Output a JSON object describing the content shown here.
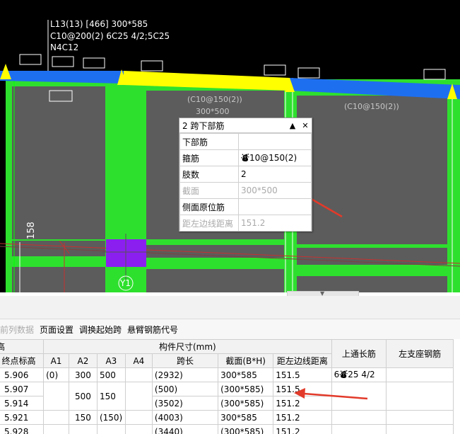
{
  "drawing": {
    "beam_annotation": [
      "L13(13) [466] 300*585",
      "C10@200(2) 6C25 4/2;5C25",
      "N4C12"
    ],
    "span_label_1": "(C10@150(2))",
    "span_size_1": "300*500",
    "span_label_2": "(C10@150(2))",
    "dimension_label": "158",
    "column_label": "Y1",
    "colors": {
      "background": "#000000",
      "beam_blue": "#1e6ff0",
      "beam_yellow": "#ffff00",
      "green": "#2ee02e",
      "slab_gray": "#5c5c5c",
      "column_purple": "#8a1ff0"
    }
  },
  "panel": {
    "title": "2 跨下部筋",
    "rows": [
      {
        "label": "下部筋",
        "value": ""
      },
      {
        "label": "箍筋",
        "value": "⛇10@150(2)"
      },
      {
        "label": "肢数",
        "value": "2"
      },
      {
        "label": "截面",
        "value": "300*500"
      },
      {
        "label": "侧面原位筋",
        "value": ""
      },
      {
        "label": "距左边线距离",
        "value": "151.2"
      }
    ]
  },
  "toolbar": {
    "items": [
      "当前列数据",
      "页面设置",
      "调换起始跨",
      "悬臂钢筋代号"
    ]
  },
  "table": {
    "group_header_left": "高",
    "group_header_mid": "构件尺寸(mm)",
    "col_headers": [
      "终点标高",
      "A1",
      "A2",
      "A3",
      "A4",
      "跨长",
      "截面(B*H)",
      "距左边线距离"
    ],
    "col_upper_rebar": "上通长筋",
    "col_left_support": "左支座钢筋",
    "rows": [
      {
        "end_elev": "5.906",
        "a1": "(0)",
        "a2": "300",
        "a3": "500",
        "a4": "",
        "span": "(2932)",
        "section": "300*585",
        "dist": "151.5",
        "upper": "6⛇25 4/2",
        "left": ""
      },
      {
        "end_elev": "5.907",
        "a1": "",
        "a2": "",
        "a3": "",
        "a4": "",
        "span": "(500)",
        "section": "(300*585)",
        "dist": "151.5",
        "upper": "",
        "left": ""
      },
      {
        "end_elev": "5.914",
        "a1": "",
        "a2": "500",
        "a3": "150",
        "a4": "",
        "span": "(3502)",
        "section": "(300*585)",
        "dist": "151.2",
        "upper": "",
        "left": ""
      },
      {
        "end_elev": "5.921",
        "a1": "",
        "a2": "150",
        "a3": "(150)",
        "a4": "",
        "span": "(4003)",
        "section": "300*585",
        "dist": "151.2",
        "upper": "",
        "left": ""
      },
      {
        "end_elev": "5.928",
        "a1": "",
        "a2": "",
        "a3": "",
        "a4": "",
        "span": "(3440)",
        "section": "(300*585)",
        "dist": "151.2",
        "upper": "",
        "left": ""
      }
    ]
  }
}
